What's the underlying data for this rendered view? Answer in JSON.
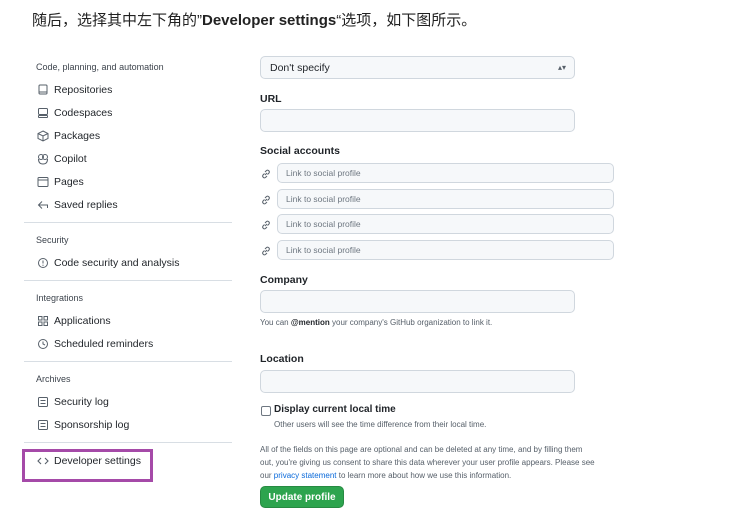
{
  "caption": {
    "prefix": "随后，选择其中左下角的”",
    "bold": "Developer settings",
    "suffix": "“选项，如下图所示。"
  },
  "sidebar": {
    "group1_title": "Code, planning, and automation",
    "group1": [
      {
        "label": "Repositories",
        "icon": "repo-icon"
      },
      {
        "label": "Codespaces",
        "icon": "codespaces-icon"
      },
      {
        "label": "Packages",
        "icon": "package-icon"
      },
      {
        "label": "Copilot",
        "icon": "copilot-icon"
      },
      {
        "label": "Pages",
        "icon": "browser-icon"
      },
      {
        "label": "Saved replies",
        "icon": "reply-icon"
      }
    ],
    "group2_title": "Security",
    "group2": [
      {
        "label": "Code security and analysis",
        "icon": "shield-icon"
      }
    ],
    "group3_title": "Integrations",
    "group3": [
      {
        "label": "Applications",
        "icon": "apps-icon"
      },
      {
        "label": "Scheduled reminders",
        "icon": "clock-icon"
      }
    ],
    "group4_title": "Archives",
    "group4": [
      {
        "label": "Security log",
        "icon": "log-icon"
      },
      {
        "label": "Sponsorship log",
        "icon": "log-icon"
      }
    ],
    "dev_settings": {
      "label": "Developer settings",
      "icon": "code-icon"
    },
    "highlight_color": "#a54aa8"
  },
  "form": {
    "pronouns_value": "Don't specify",
    "url_label": "URL",
    "social_label": "Social accounts",
    "social_placeholder": "Link to social profile",
    "company_label": "Company",
    "company_note_prefix": "You can ",
    "company_note_mention": "@mention",
    "company_note_suffix": " your company's GitHub organization to link it.",
    "location_label": "Location",
    "local_time_label": "Display current local time",
    "local_time_note": "Other users will see the time difference from their local time.",
    "footer_line1": "All of the fields on this page are optional and can be deleted at any time, and by filling them",
    "footer_line2": "out, you're giving us consent to share this data wherever your user profile appears. Please see",
    "footer_line3_prefix": "our ",
    "footer_link": "privacy statement",
    "footer_line3_suffix": " to learn more about how we use this information.",
    "submit_label": "Update profile",
    "submit_color": "#2da44e"
  }
}
